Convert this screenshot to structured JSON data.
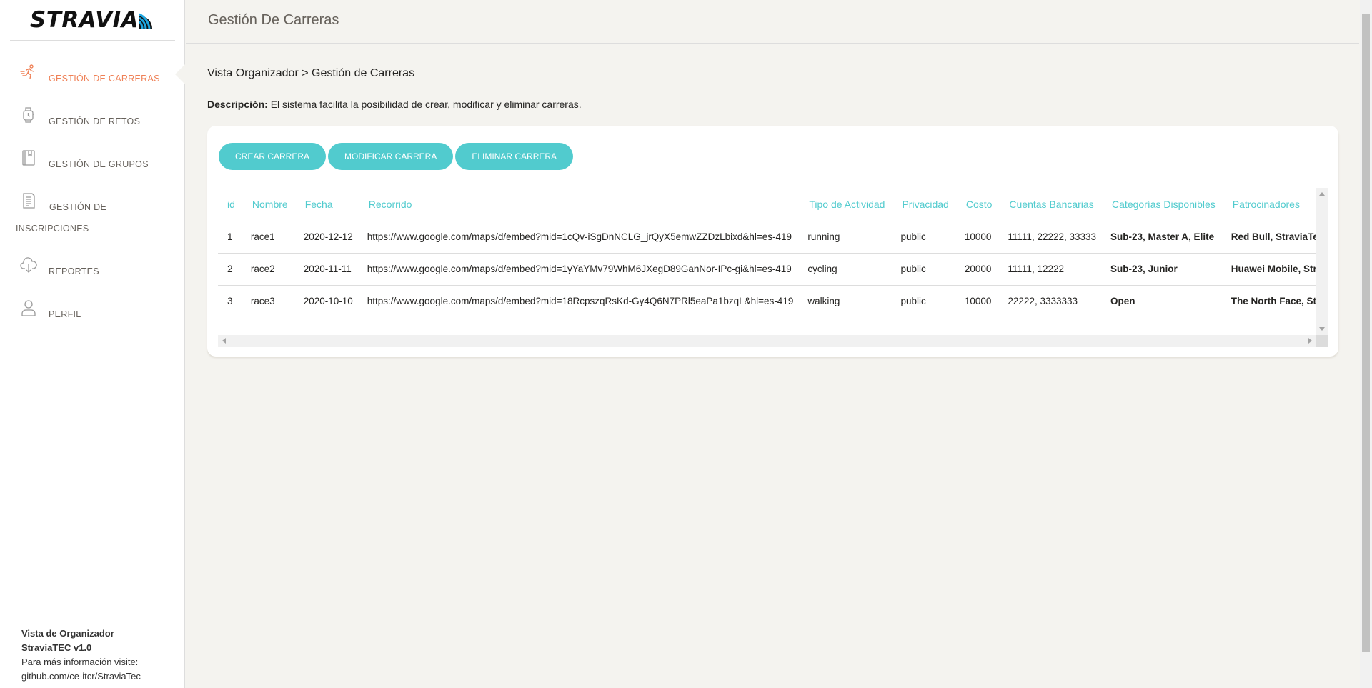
{
  "brand": {
    "logo_text": "STRAVIA"
  },
  "sidebar": {
    "items": [
      {
        "label": "Gestión de Carreras",
        "icon": "runner-icon",
        "active": true
      },
      {
        "label": "Gestión de Retos",
        "icon": "watch-icon",
        "active": false
      },
      {
        "label": "Gestión de Grupos",
        "icon": "book-icon",
        "active": false
      },
      {
        "label_line1": "Gestión de",
        "label_line2": "Inscripciones",
        "icon": "document-icon",
        "active": false
      },
      {
        "label": "Reportes",
        "icon": "cloud-download-icon",
        "active": false
      },
      {
        "label": "Perfil",
        "icon": "user-icon",
        "active": false
      }
    ],
    "footer": {
      "line1": "Vista de Organizador",
      "line2": "StraviaTEC v1.0",
      "line3": "Para más información visite:",
      "line4": "github.com/ce-itcr/StraviaTec"
    }
  },
  "topbar": {
    "title": "Gestión De Carreras"
  },
  "main": {
    "breadcrumb": "Vista Organizador > Gestión de Carreras",
    "description_label": "Descripción:",
    "description_text": " El sistema facilita la posibilidad de crear, modificar y eliminar carreras.",
    "buttons": {
      "create": "Crear Carrera",
      "modify": "Modificar Carrera",
      "delete": "Eliminar Carrera"
    },
    "table": {
      "headers": [
        "id",
        "Nombre",
        "Fecha",
        "Recorrido",
        "Tipo de Actividad",
        "Privacidad",
        "Costo",
        "Cuentas Bancarias",
        "Categorías Disponibles",
        "Patrocinadores"
      ],
      "rows": [
        [
          "1",
          "race1",
          "2020-12-12",
          "https://www.google.com/maps/d/embed?mid=1cQv-iSgDnNCLG_jrQyX5emwZZDzLbixd&hl=es-419",
          "running",
          "public",
          "10000",
          "11111, 22222, 33333",
          "Sub-23, Master A, Elite",
          "Red Bull, StraviaTec"
        ],
        [
          "2",
          "race2",
          "2020-11-11",
          "https://www.google.com/maps/d/embed?mid=1yYaYMv79WhM6JXegD89GanNor-IPc-gi&hl=es-419",
          "cycling",
          "public",
          "20000",
          "11111, 12222",
          "Sub-23, Junior",
          "Huawei Mobile, Strava"
        ],
        [
          "3",
          "race3",
          "2020-10-10",
          "https://www.google.com/maps/d/embed?mid=18RcpszqRsKd-Gy4Q6N7PRl5eaPa1bzqL&hl=es-419",
          "walking",
          "public",
          "10000",
          "22222, 3333333",
          "Open",
          "The North Face, Strava, StraviaTec"
        ]
      ]
    }
  },
  "colors": {
    "accent": "#51cbce",
    "active_nav": "#ef8157",
    "background": "#f4f3ef"
  }
}
